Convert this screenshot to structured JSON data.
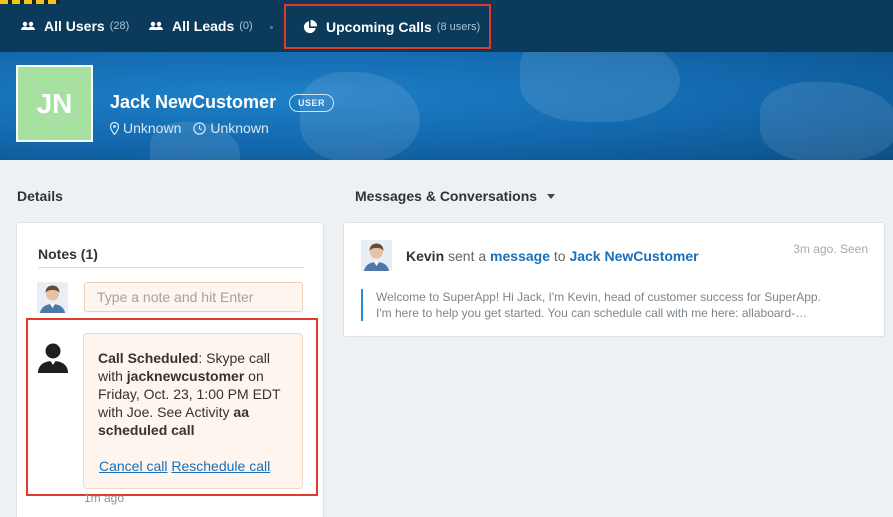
{
  "nav": {
    "tabs": [
      {
        "label": "All Users",
        "count": "(28)",
        "icon": "users-icon"
      },
      {
        "label": "All Leads",
        "count": "(0)",
        "icon": "users-icon"
      },
      {
        "label": "Upcoming Calls",
        "count": "(8 users)",
        "icon": "pie-chart-icon"
      }
    ]
  },
  "profile": {
    "initials": "JN",
    "name": "Jack NewCustomer",
    "badge": "USER",
    "location": "Unknown",
    "timezone": "Unknown",
    "avatar_color": "#a6e1a2"
  },
  "details": {
    "title": "Details",
    "notes_title": "Notes (1)",
    "note_placeholder": "Type a note and hit Enter",
    "note": {
      "title": "Call Scheduled",
      "text1": ": Skype call with ",
      "handle": "jacknewcustomer",
      "text2": " on Friday, Oct. 23, 1:00 PM EDT with Joe. See Activity ",
      "activity": "aa scheduled call",
      "cancel": "Cancel call",
      "reschedule": "Reschedule call",
      "time": "1m ago"
    }
  },
  "messages": {
    "title": "Messages & Conversations",
    "item": {
      "sender": "Kevin",
      "sent_a": "sent a",
      "message_link": "message",
      "to": "to",
      "recipient": "Jack NewCustomer",
      "time": "3m ago. Seen",
      "line1": "Welcome to SuperApp! Hi Jack, I'm Kevin, head of customer success for SuperApp.",
      "line2": "I'm here to help you get started. You can schedule call with me here: allaboard-…"
    }
  },
  "colors": {
    "nav_bg": "#0b3a5a",
    "banner_bg": "#1368ad",
    "highlight": "#e03a2f",
    "link": "#1a6fb7"
  }
}
